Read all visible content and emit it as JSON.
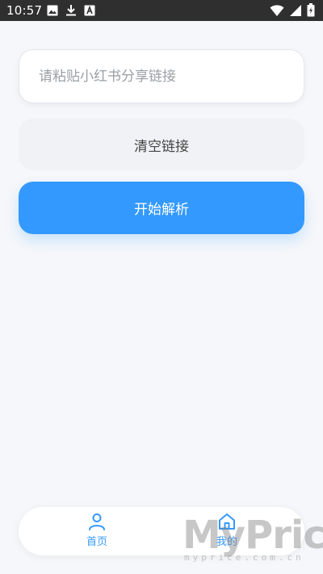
{
  "status_bar": {
    "time": "10:57",
    "icons": [
      "image-icon",
      "download-icon",
      "font-icon",
      "wifi-icon",
      "signal-icon",
      "battery-icon"
    ]
  },
  "input": {
    "placeholder": "请粘贴小红书分享链接",
    "value": ""
  },
  "buttons": {
    "clear_label": "清空链接",
    "parse_label": "开始解析"
  },
  "nav": {
    "items": [
      {
        "label": "首页",
        "icon": "user-icon"
      },
      {
        "label": "我的",
        "icon": "home-icon"
      }
    ]
  },
  "watermark": {
    "main": "MyPrice",
    "sub": "myprice.com.cn"
  },
  "colors": {
    "accent": "#3399ff",
    "background": "#f5f7fa",
    "status_bar": "#2f2f2f"
  }
}
